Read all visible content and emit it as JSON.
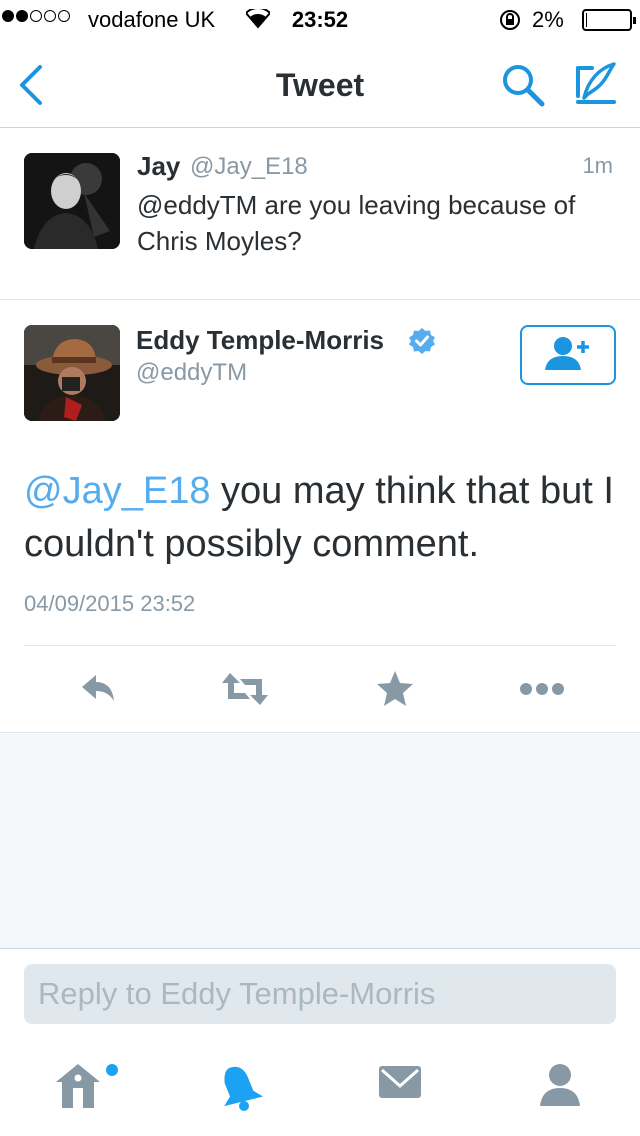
{
  "status_bar": {
    "carrier": "vodafone UK",
    "time": "23:52",
    "battery_percent": "2%",
    "battery_level": 0.02,
    "signal_bars_filled": 2,
    "signal_bars_total": 5
  },
  "nav": {
    "title": "Tweet",
    "back_icon": "chevron-left-icon",
    "search_icon": "search-icon",
    "compose_icon": "compose-quill-icon",
    "accent_color": "#1b95e0"
  },
  "parent_tweet": {
    "name": "Jay",
    "handle": "@Jay_E18",
    "time": "1m",
    "text": "@eddyTM are you leaving because of Chris Moyles?"
  },
  "main_tweet": {
    "name": "Eddy Temple-Morris",
    "handle": "@eddyTM",
    "verified": true,
    "mention": "@Jay_E18",
    "text_rest": " you may think that but I couldn't possibly comment.",
    "timestamp": "04/09/2015 23:52",
    "follow_icon": "add-user-icon",
    "actions": [
      "reply-icon",
      "retweet-icon",
      "favorite-star-icon",
      "more-dots-icon"
    ]
  },
  "reply": {
    "placeholder": "Reply to Eddy Temple-Morris"
  },
  "tab_bar": {
    "items": [
      "home-icon",
      "notifications-bell-icon",
      "messages-icon",
      "profile-icon"
    ],
    "active": "notifications-bell-icon",
    "home_has_dot": true
  }
}
